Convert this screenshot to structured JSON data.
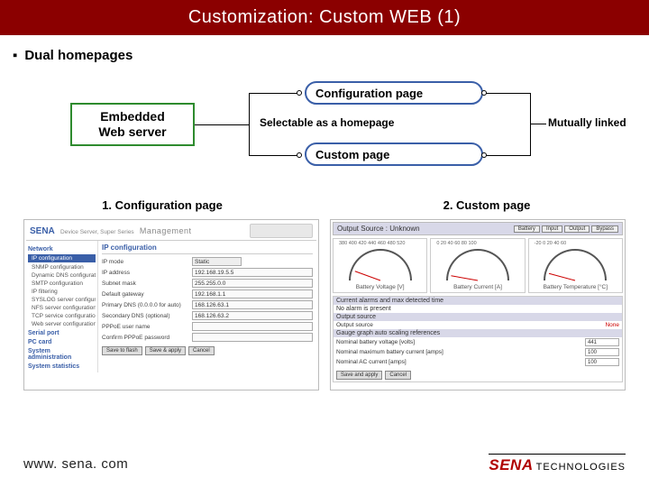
{
  "title": "Customization: Custom WEB (1)",
  "subtitle": "Dual homepages",
  "diagram": {
    "embedded": "Embedded\nWeb server",
    "config_page": "Configuration page",
    "custom_page": "Custom page",
    "selectable": "Selectable as a homepage",
    "mutual": "Mutually linked"
  },
  "captions": {
    "left": "1. Configuration page",
    "right": "2. Custom page"
  },
  "shot1": {
    "logo": "SENA",
    "header": "Device Server, Super Series",
    "mgmt": "Management",
    "nav": {
      "groups": [
        "Network",
        "Serial port",
        "PC card",
        "System administration",
        "System statistics"
      ],
      "items_network": [
        "IP configuration",
        "SNMP configuration",
        "Dynamic DNS configuration",
        "SMTP configuration",
        "IP filtering",
        "SYSLOG server configuration",
        "NFS server configuration",
        "TCP service configuration",
        "Web server configuration"
      ]
    },
    "panel_title": "IP configuration",
    "rows": [
      {
        "label": "IP mode",
        "value": "Static",
        "select": true
      },
      {
        "label": "IP address",
        "value": "192.168.19.5.5"
      },
      {
        "label": "Subnet mask",
        "value": "255.255.0.0"
      },
      {
        "label": "Default gateway",
        "value": "192.168.1.1"
      },
      {
        "label": "Primary DNS (0.0.0.0 for auto)",
        "value": "168.126.63.1"
      },
      {
        "label": "Secondary DNS (optional)",
        "value": "168.126.63.2"
      },
      {
        "label": "PPPoE user name",
        "value": ""
      },
      {
        "label": "Confirm PPPoE password",
        "value": ""
      }
    ],
    "buttons": [
      "Save to flash",
      "Save & apply",
      "Cancel"
    ]
  },
  "shot2": {
    "src_label": "Output Source : Unknown",
    "src_buttons": [
      "Battery",
      "Input",
      "Output",
      "Bypass"
    ],
    "gauges": [
      {
        "label": "Battery Voltage [V]",
        "ticks": "380  400  420  440  460  480  520",
        "angle": -70
      },
      {
        "label": "Battery Current [A]",
        "ticks": "0  20  40  60  80  100",
        "angle": -80
      },
      {
        "label": "Battery Temperature [°C]",
        "ticks": "-20  0  20  40  60",
        "angle": -75
      }
    ],
    "alarms_header": "Current alarms and max detected time",
    "alarms_text": "No alarm is present",
    "output_header": "Output source",
    "output_value": "None",
    "scaling_header": "Gauge graph auto scaling references",
    "scaling_rows": [
      {
        "label": "Nominal battery voltage [volts]",
        "value": "441"
      },
      {
        "label": "Nominal maximum battery current [amps]",
        "value": "100"
      },
      {
        "label": "Nominal AC current [amps]",
        "value": "100"
      }
    ],
    "buttons": [
      "Save and apply",
      "Cancel"
    ]
  },
  "footer": {
    "url": "www. sena. com",
    "brand1": "SENA",
    "brand2": "TECHNOLOGIES"
  }
}
